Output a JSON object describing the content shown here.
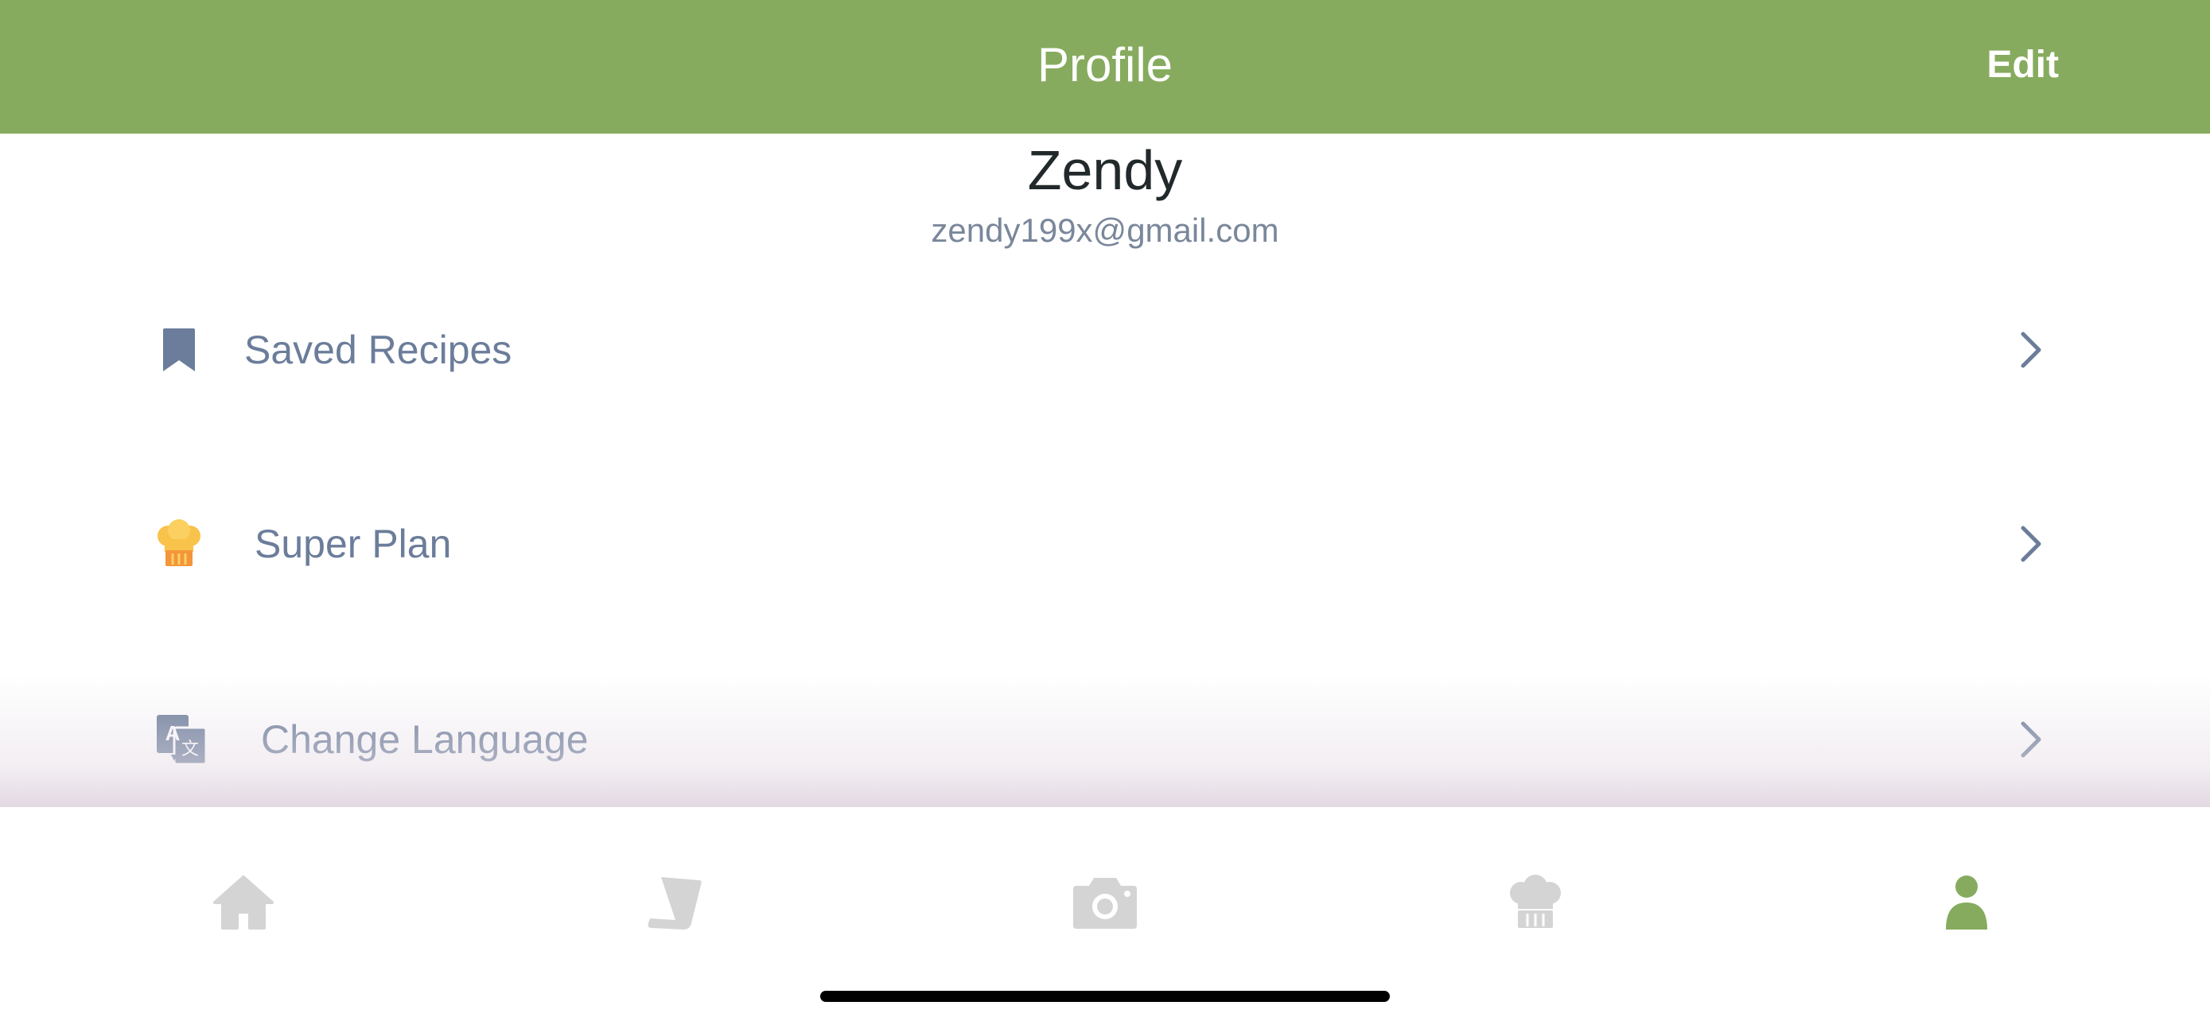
{
  "header": {
    "title": "Profile",
    "edit_label": "Edit",
    "background_color": "#86ab5e"
  },
  "profile": {
    "name": "Zendy",
    "email": "zendy199x@gmail.com"
  },
  "menu": {
    "items": [
      {
        "icon": "bookmark-icon",
        "label": "Saved Recipes"
      },
      {
        "icon": "chef-hat-icon",
        "label": "Super Plan"
      },
      {
        "icon": "translate-icon",
        "label": "Change Language"
      }
    ],
    "text_color": "#6b7d9a"
  },
  "tabbar": {
    "tabs": [
      {
        "icon": "home-icon",
        "active": false
      },
      {
        "icon": "recipe-scroll-icon",
        "active": false
      },
      {
        "icon": "camera-icon",
        "active": false
      },
      {
        "icon": "chef-hat-icon",
        "active": false
      },
      {
        "icon": "user-icon",
        "active": true
      }
    ],
    "active_color": "#86ab5e",
    "inactive_color": "#d4d4d4"
  }
}
